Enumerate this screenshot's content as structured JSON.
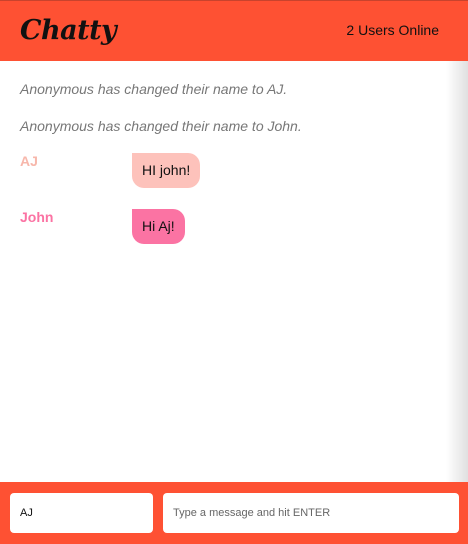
{
  "navbar": {
    "brand": "Chatty",
    "users_online": "2 Users Online"
  },
  "notifications": [
    "Anonymous has changed their name to AJ.",
    "Anonymous has changed their name to John."
  ],
  "messages": [
    {
      "username": "AJ",
      "content": "HI john!",
      "username_color": "#f7b7ab",
      "bubble_color": "#fdc2bb"
    },
    {
      "username": "John",
      "content": "Hi Aj!",
      "username_color": "#fb73a3",
      "bubble_color": "#fb73a3"
    }
  ],
  "chatbar": {
    "username_value": "AJ",
    "message_placeholder": "Type a message and hit ENTER"
  },
  "colors": {
    "accent": "#fe5133"
  }
}
